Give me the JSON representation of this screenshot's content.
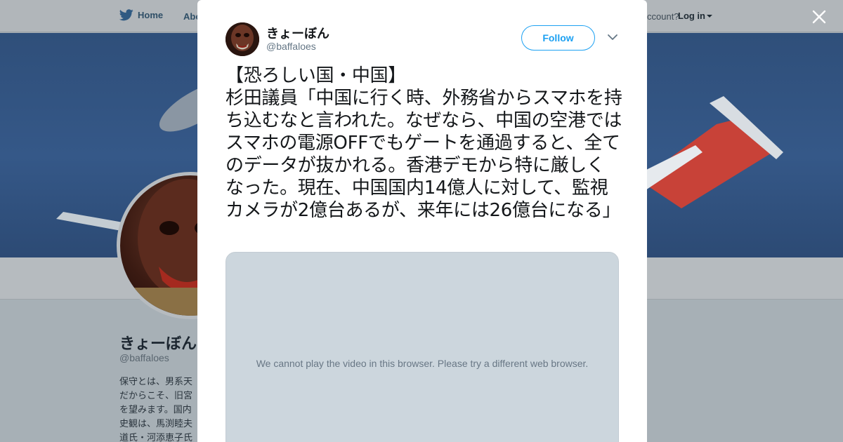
{
  "background_page": {
    "nav": {
      "home_label": "Home",
      "about_label": "Abo",
      "account_prompt": "ccount?",
      "login_label": "Log in"
    },
    "profile": {
      "name": "きょーぼん",
      "handle": "@baffaloes",
      "bio_lines": "保守とは、男系天\nだからこそ、旧宮\nを望みます。国内\n史観は、馬渕睦夫\n道氏・河添恵子氏"
    }
  },
  "modal": {
    "author": {
      "name": "きょーぼん",
      "handle": "@baffaloes"
    },
    "follow_label": "Follow",
    "tweet_text": "【恐ろしい国・中国】\n杉田議員「中国に行く時、外務省からスマホを持ち込むなと言われた。なぜなら、中国の空港ではスマホの電源OFFでもゲートを通過すると、全てのデータが抜かれる。香港デモから特に厳しくなった。現在、中国国内14億人に対して、監視カメラが2億台あるが、来年には26億台になる」",
    "video_message": "We cannot play the video in this browser. Please try a different web browser."
  },
  "icons": {
    "bird": "twitter-bird-icon",
    "close": "close-icon",
    "chevron": "chevron-down-icon"
  },
  "colors": {
    "accent": "#1da1f2",
    "text": "#14171a",
    "secondary_text": "#657786",
    "video_bg": "#ccd6dd",
    "overlay_bg": "#a7b0b6"
  }
}
